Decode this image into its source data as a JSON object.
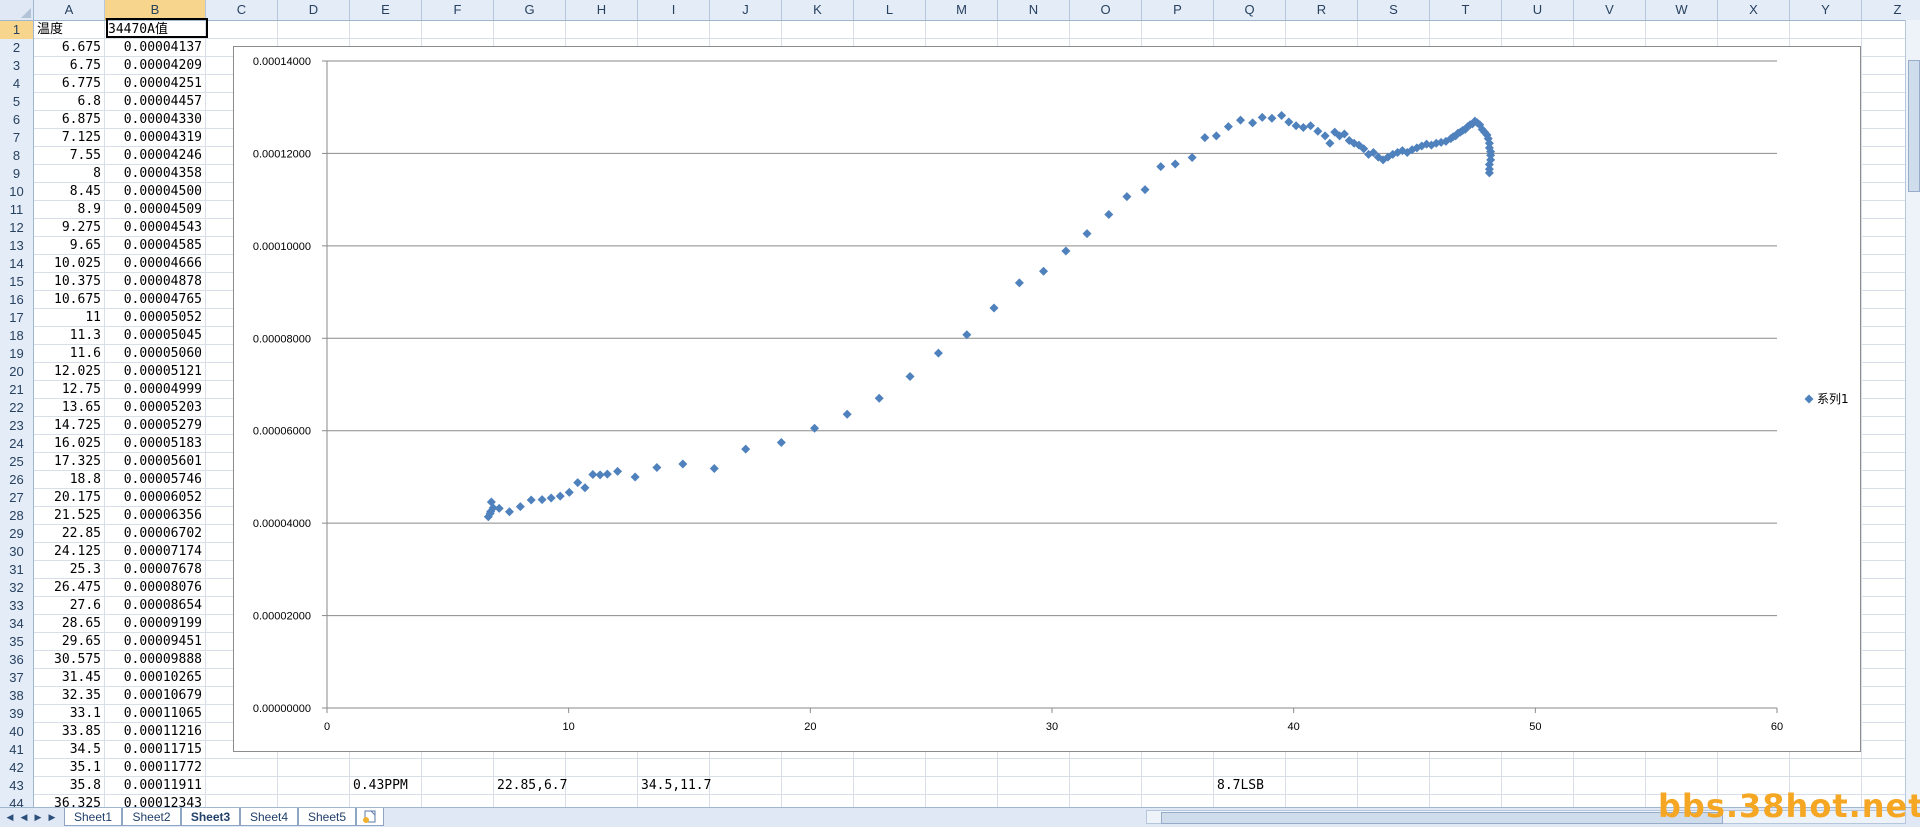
{
  "columns": [
    "A",
    "B",
    "C",
    "D",
    "E",
    "F",
    "G",
    "H",
    "I",
    "J",
    "K",
    "L",
    "M",
    "N",
    "O",
    "P",
    "Q",
    "R",
    "S",
    "T",
    "U",
    "V",
    "W",
    "X",
    "Y",
    "Z"
  ],
  "selected_column": "B",
  "selected_row": 1,
  "rows": [
    {
      "n": "1",
      "a": "温度",
      "b": "34470A值"
    },
    {
      "n": "2",
      "a": "6.675",
      "b": "0.00004137"
    },
    {
      "n": "3",
      "a": "6.75",
      "b": "0.00004209"
    },
    {
      "n": "4",
      "a": "6.775",
      "b": "0.00004251"
    },
    {
      "n": "5",
      "a": "6.8",
      "b": "0.00004457"
    },
    {
      "n": "6",
      "a": "6.875",
      "b": "0.00004330"
    },
    {
      "n": "7",
      "a": "7.125",
      "b": "0.00004319"
    },
    {
      "n": "8",
      "a": "7.55",
      "b": "0.00004246"
    },
    {
      "n": "9",
      "a": "8",
      "b": "0.00004358"
    },
    {
      "n": "10",
      "a": "8.45",
      "b": "0.00004500"
    },
    {
      "n": "11",
      "a": "8.9",
      "b": "0.00004509"
    },
    {
      "n": "12",
      "a": "9.275",
      "b": "0.00004543"
    },
    {
      "n": "13",
      "a": "9.65",
      "b": "0.00004585"
    },
    {
      "n": "14",
      "a": "10.025",
      "b": "0.00004666"
    },
    {
      "n": "15",
      "a": "10.375",
      "b": "0.00004878"
    },
    {
      "n": "16",
      "a": "10.675",
      "b": "0.00004765"
    },
    {
      "n": "17",
      "a": "11",
      "b": "0.00005052"
    },
    {
      "n": "18",
      "a": "11.3",
      "b": "0.00005045"
    },
    {
      "n": "19",
      "a": "11.6",
      "b": "0.00005060"
    },
    {
      "n": "20",
      "a": "12.025",
      "b": "0.00005121"
    },
    {
      "n": "21",
      "a": "12.75",
      "b": "0.00004999"
    },
    {
      "n": "22",
      "a": "13.65",
      "b": "0.00005203"
    },
    {
      "n": "23",
      "a": "14.725",
      "b": "0.00005279"
    },
    {
      "n": "24",
      "a": "16.025",
      "b": "0.00005183"
    },
    {
      "n": "25",
      "a": "17.325",
      "b": "0.00005601"
    },
    {
      "n": "26",
      "a": "18.8",
      "b": "0.00005746"
    },
    {
      "n": "27",
      "a": "20.175",
      "b": "0.00006052"
    },
    {
      "n": "28",
      "a": "21.525",
      "b": "0.00006356"
    },
    {
      "n": "29",
      "a": "22.85",
      "b": "0.00006702"
    },
    {
      "n": "30",
      "a": "24.125",
      "b": "0.00007174"
    },
    {
      "n": "31",
      "a": "25.3",
      "b": "0.00007678"
    },
    {
      "n": "32",
      "a": "26.475",
      "b": "0.00008076"
    },
    {
      "n": "33",
      "a": "27.6",
      "b": "0.00008654"
    },
    {
      "n": "34",
      "a": "28.65",
      "b": "0.00009199"
    },
    {
      "n": "35",
      "a": "29.65",
      "b": "0.00009451"
    },
    {
      "n": "36",
      "a": "30.575",
      "b": "0.00009888"
    },
    {
      "n": "37",
      "a": "31.45",
      "b": "0.00010265"
    },
    {
      "n": "38",
      "a": "32.35",
      "b": "0.00010679"
    },
    {
      "n": "39",
      "a": "33.1",
      "b": "0.00011065"
    },
    {
      "n": "40",
      "a": "33.85",
      "b": "0.00011216"
    },
    {
      "n": "41",
      "a": "34.5",
      "b": "0.00011715"
    },
    {
      "n": "42",
      "a": "35.1",
      "b": "0.00011772"
    },
    {
      "n": "43",
      "a": "35.8",
      "b": "0.00011911"
    },
    {
      "n": "44",
      "a": "36.325",
      "b": "0.00012343"
    }
  ],
  "row43_extra": {
    "E": "0.43PPM",
    "G": "22.85,6.7",
    "I": "34.5,11.7",
    "Q": "8.7LSB"
  },
  "sheet_tabs": [
    "Sheet1",
    "Sheet2",
    "Sheet3",
    "Sheet4",
    "Sheet5"
  ],
  "active_sheet": "Sheet3",
  "watermark": "bbs.38hot.net",
  "chart_data": {
    "type": "scatter",
    "series": [
      {
        "name": "系列1",
        "color": "#4f81bd",
        "x": [
          6.675,
          6.75,
          6.775,
          6.8,
          6.875,
          7.125,
          7.55,
          8,
          8.45,
          8.9,
          9.275,
          9.65,
          10.025,
          10.375,
          10.675,
          11,
          11.3,
          11.6,
          12.025,
          12.75,
          13.65,
          14.725,
          16.025,
          17.325,
          18.8,
          20.175,
          21.525,
          22.85,
          24.125,
          25.3,
          26.475,
          27.6,
          28.65,
          29.65,
          30.575,
          31.45,
          32.35,
          33.1,
          33.85,
          34.5,
          35.1,
          35.8,
          36.325,
          36.8,
          37.3,
          37.8,
          38.3,
          38.7,
          39.1,
          39.5,
          39.8,
          40.1,
          40.4,
          40.7,
          41.0,
          41.3,
          41.5,
          41.7,
          41.9,
          42.1,
          42.3,
          42.5,
          42.7,
          42.9,
          43.1,
          43.3,
          43.5,
          43.7,
          43.9,
          44.1,
          44.3,
          44.5,
          44.7,
          44.9,
          45.1,
          45.3,
          45.5,
          45.7,
          45.9,
          46.1,
          46.3,
          46.5,
          46.6,
          46.7,
          46.8,
          46.9,
          47.0,
          47.1,
          47.2,
          47.3,
          47.4,
          47.5,
          47.6,
          47.7,
          47.8,
          47.9,
          48.0,
          48.05,
          48.1,
          48.1,
          48.15,
          48.15,
          48.15,
          48.1,
          48.1,
          48.1
        ],
        "y": [
          4.137e-05,
          4.209e-05,
          4.251e-05,
          4.457e-05,
          4.33e-05,
          4.319e-05,
          4.246e-05,
          4.358e-05,
          4.5e-05,
          4.509e-05,
          4.543e-05,
          4.585e-05,
          4.666e-05,
          4.878e-05,
          4.765e-05,
          5.052e-05,
          5.045e-05,
          5.06e-05,
          5.121e-05,
          4.999e-05,
          5.203e-05,
          5.279e-05,
          5.183e-05,
          5.601e-05,
          5.746e-05,
          6.052e-05,
          6.356e-05,
          6.702e-05,
          7.174e-05,
          7.678e-05,
          8.076e-05,
          8.654e-05,
          9.199e-05,
          9.451e-05,
          9.888e-05,
          0.00010265,
          0.00010679,
          0.00011065,
          0.00011216,
          0.00011715,
          0.00011772,
          0.00011911,
          0.00012343,
          0.0001238,
          0.0001258,
          0.0001272,
          0.0001266,
          0.0001278,
          0.0001276,
          0.0001282,
          0.0001268,
          0.000126,
          0.0001256,
          0.000126,
          0.0001248,
          0.0001238,
          0.0001222,
          0.0001246,
          0.0001238,
          0.0001242,
          0.0001228,
          0.0001222,
          0.0001218,
          0.000121,
          0.0001198,
          0.0001202,
          0.0001192,
          0.0001186,
          0.0001192,
          0.0001198,
          0.0001202,
          0.0001206,
          0.0001202,
          0.0001208,
          0.0001212,
          0.0001216,
          0.000122,
          0.0001218,
          0.0001222,
          0.0001224,
          0.0001226,
          0.0001232,
          0.0001236,
          0.0001238,
          0.0001244,
          0.0001246,
          0.000125,
          0.0001252,
          0.0001258,
          0.0001262,
          0.0001264,
          0.000127,
          0.0001266,
          0.0001262,
          0.0001252,
          0.0001246,
          0.000124,
          0.0001232,
          0.0001222,
          0.0001212,
          0.0001204,
          0.0001196,
          0.0001186,
          0.0001176,
          0.0001166,
          0.0001158
        ]
      }
    ],
    "title": "",
    "xlabel": "",
    "ylabel": "",
    "xlim": [
      0,
      60
    ],
    "ylim": [
      0,
      0.00014
    ],
    "xticks": [
      "0",
      "10",
      "20",
      "30",
      "40",
      "50",
      "60"
    ],
    "yticks": [
      "0.00000000",
      "0.00002000",
      "0.00004000",
      "0.00006000",
      "0.00008000",
      "0.00010000",
      "0.00012000",
      "0.00014000"
    ],
    "grid": true,
    "legend": "right",
    "marker": "diamond"
  }
}
